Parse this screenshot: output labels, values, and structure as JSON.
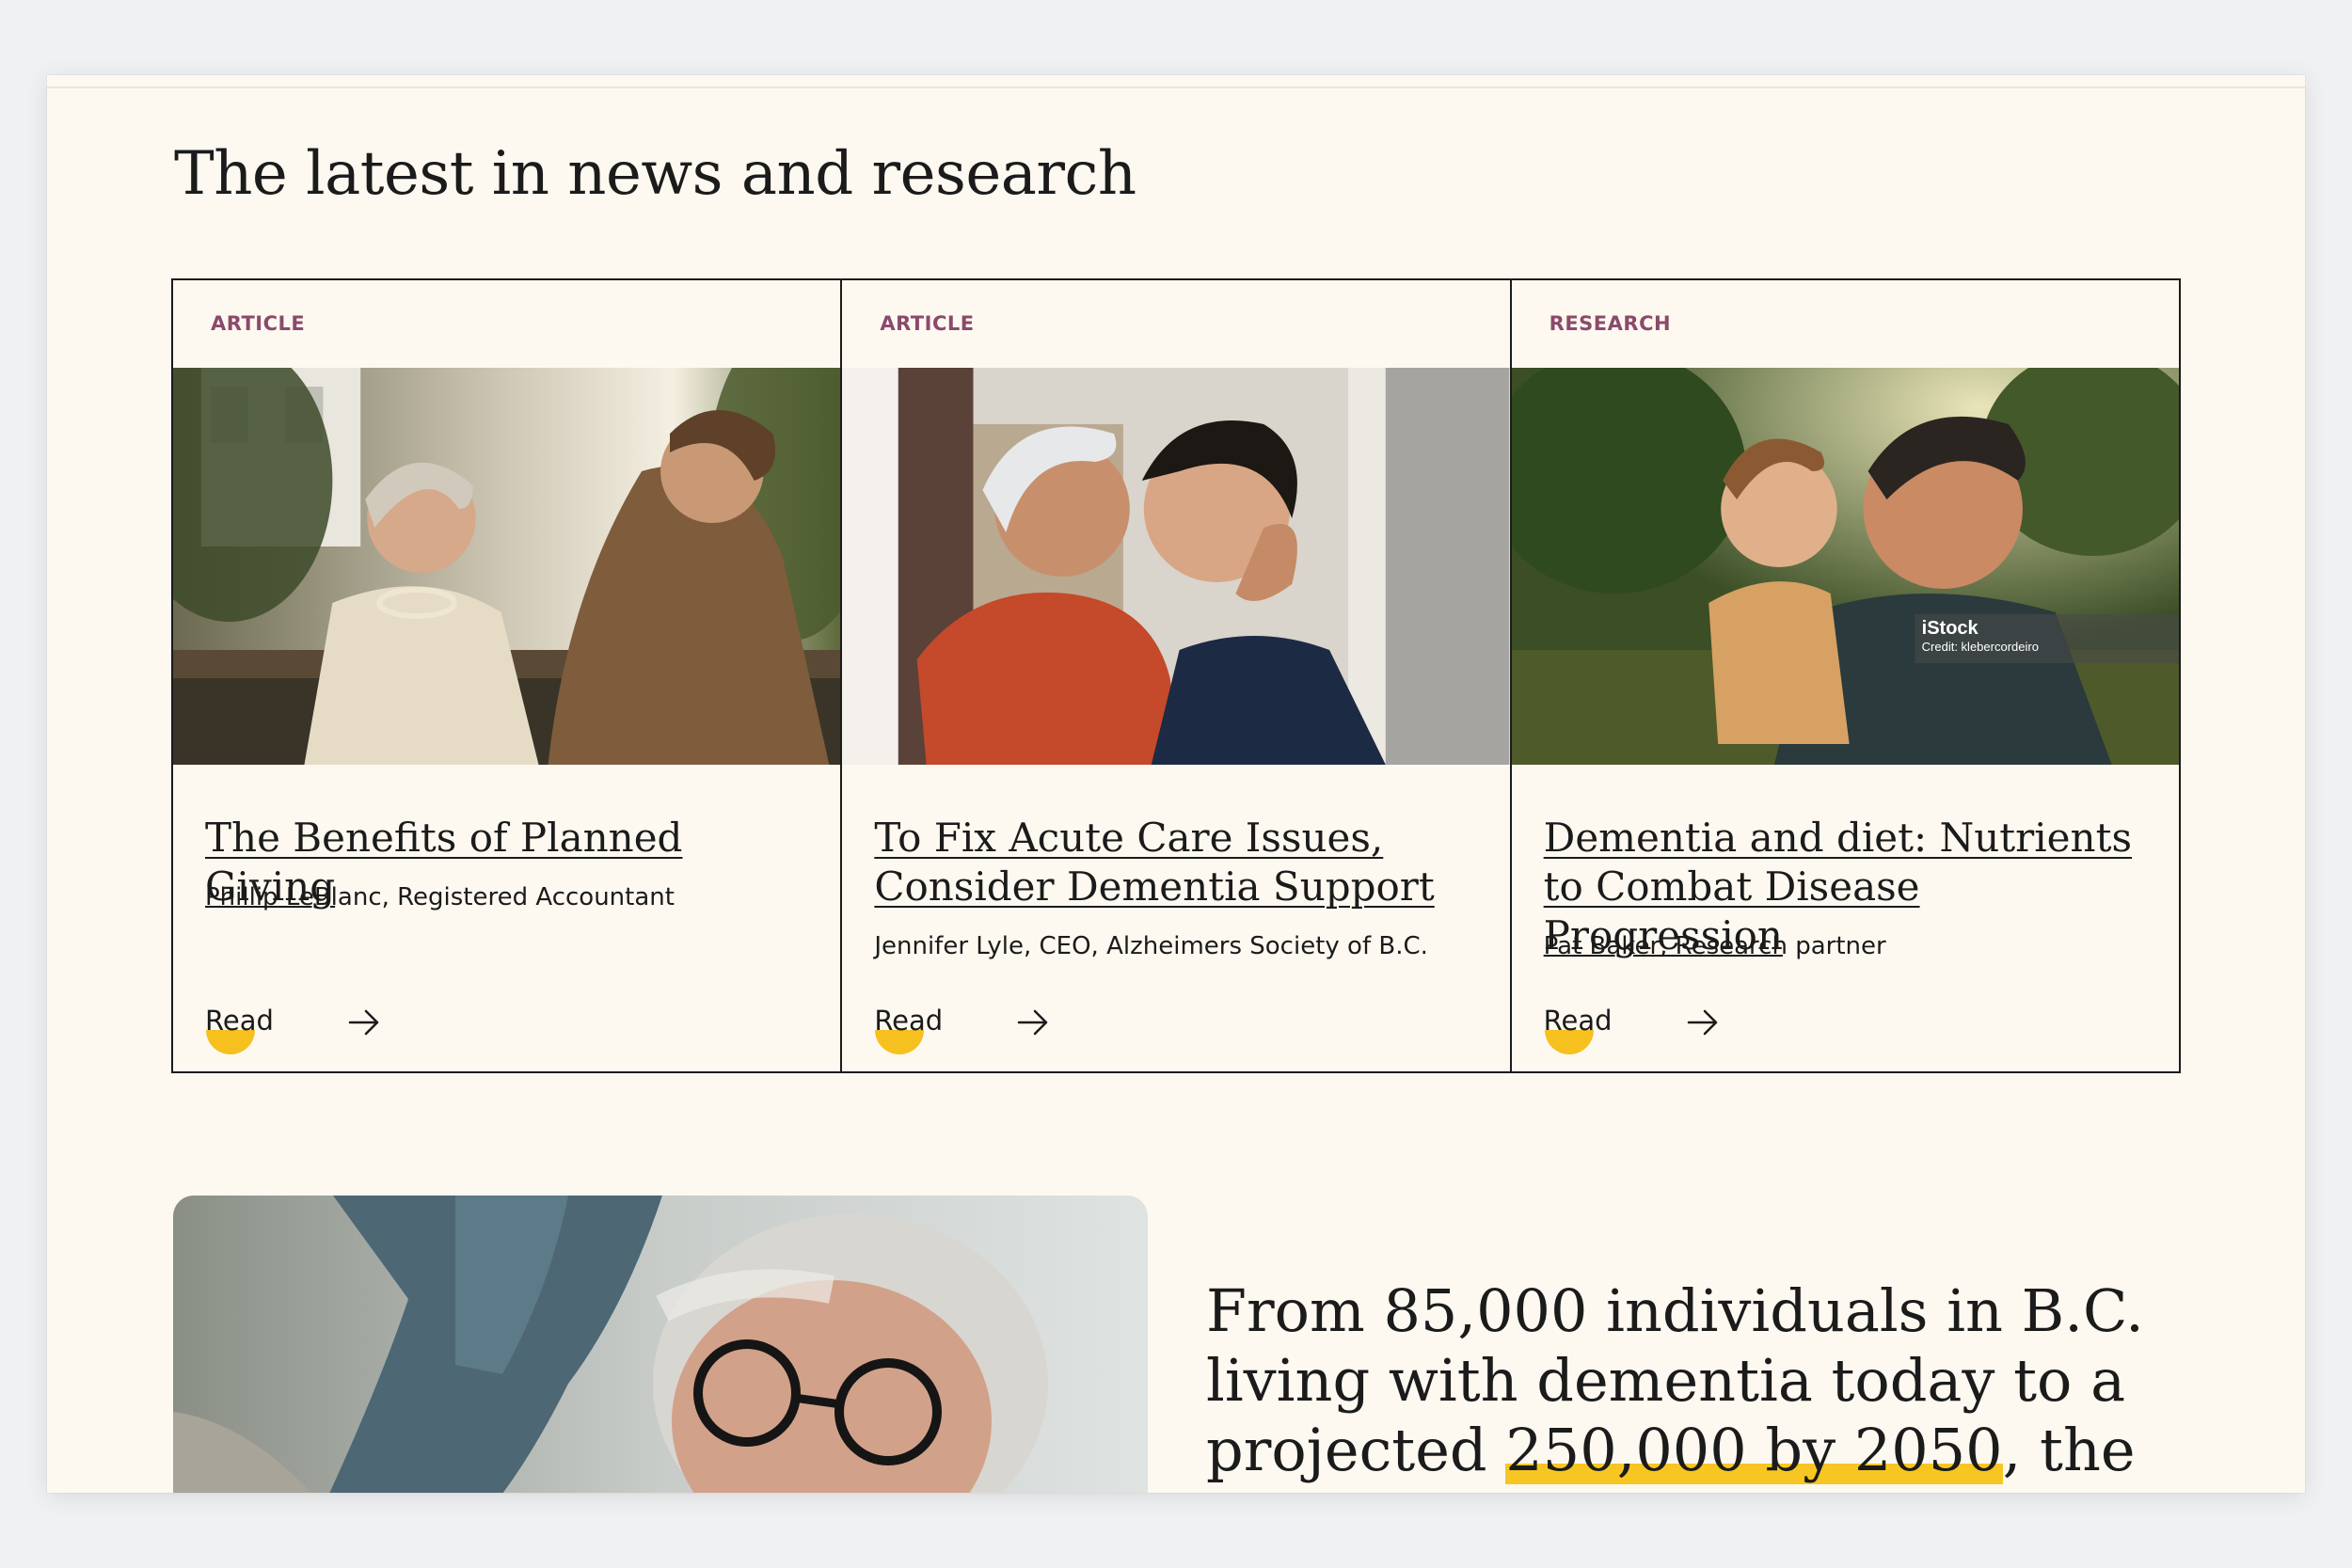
{
  "section": {
    "title": "The latest in news and research"
  },
  "cards": [
    {
      "tag": "ARTICLE",
      "title": "The Benefits of Planned Giving",
      "author": "Phillip LeBlanc, Registered Accountant",
      "read_label": "Read"
    },
    {
      "tag": "ARTICLE",
      "title": "To Fix Acute Care Issues, Consider Dementia Support",
      "author": "Jennifer Lyle, CEO, Alzheimers Society of B.C.",
      "read_label": "Read"
    },
    {
      "tag": "RESEARCH",
      "title": "Dementia and diet: Nutrients to Combat Disease Progression",
      "author": "Pat Baker, Research partner",
      "read_label": "Read",
      "image_credit": {
        "brand": "iStock",
        "credit": "Credit: klebercordeiro"
      }
    }
  ],
  "feature": {
    "text_before": "From 85,000 individuals in B.C. living with dementia today to a projected ",
    "highlight": "250,000 by 2050",
    "text_after": ", the"
  },
  "colors": {
    "accent": "#f6c01e",
    "tag": "#8b4a6a",
    "background": "#fdf9f1"
  },
  "icons": {
    "read_arrow": "arrow-right-icon"
  }
}
